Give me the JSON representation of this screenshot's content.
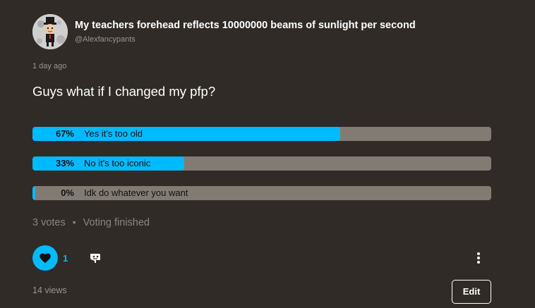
{
  "author": {
    "name": "My teachers forehead reflects 10000000 beams of sunlight per second",
    "handle": "@Alexfancypants"
  },
  "post": {
    "timestamp": "1 day ago",
    "question": "Guys what if I changed my pfp?"
  },
  "poll": {
    "options": [
      {
        "percent_label": "67%",
        "label": "Yes it's too old",
        "fraction": 0.67
      },
      {
        "percent_label": "33%",
        "label": "No it's too iconic",
        "fraction": 0.33
      },
      {
        "percent_label": "0%",
        "label": "Idk do whatever you want",
        "fraction": 0.0
      }
    ],
    "votes_label": "3 votes",
    "status_label": "Voting finished"
  },
  "actions": {
    "like_count": "1",
    "views_label": "14 views",
    "edit_label": "Edit"
  },
  "colors": {
    "accent": "#00baff",
    "background": "#302b27",
    "bar_track": "#827b74"
  },
  "icons": {
    "like": "heart-icon",
    "reaction": "reaction-icon",
    "more": "more-vertical-icon"
  }
}
